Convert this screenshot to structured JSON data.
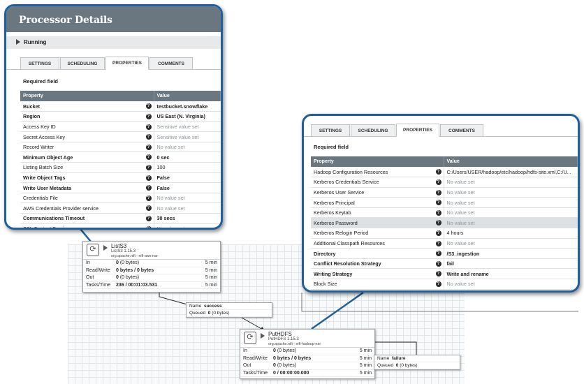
{
  "colors": {
    "callout_border": "#1f5f9c",
    "header_bg": "#6b7780",
    "highlight_row": "#dde1e4"
  },
  "processor_details": {
    "title": "Processor Details",
    "status": "Running",
    "tabs": [
      "SETTINGS",
      "SCHEDULING",
      "PROPERTIES",
      "COMMENTS"
    ],
    "active_tab": "PROPERTIES",
    "required_label": "Required field",
    "columns": [
      "Property",
      "Value"
    ],
    "rows": [
      {
        "name": "Bucket",
        "value": "testbucket.snowflake",
        "required": true,
        "kind": "set"
      },
      {
        "name": "Region",
        "value": "US East (N. Virginia)",
        "required": true,
        "kind": "set"
      },
      {
        "name": "Access Key ID",
        "value": "Sensitive value set",
        "required": false,
        "kind": "none"
      },
      {
        "name": "Secret Access Key",
        "value": "Sensitive value set",
        "required": false,
        "kind": "none"
      },
      {
        "name": "Record Writer",
        "value": "No value set",
        "required": false,
        "kind": "none"
      },
      {
        "name": "Minimum Object Age",
        "value": "0 sec",
        "required": true,
        "kind": "set"
      },
      {
        "name": "Listing Batch Size",
        "value": "100",
        "required": false,
        "kind": "plain"
      },
      {
        "name": "Write Object Tags",
        "value": "False",
        "required": true,
        "kind": "set"
      },
      {
        "name": "Write User Metadata",
        "value": "False",
        "required": true,
        "kind": "set"
      },
      {
        "name": "Credentials File",
        "value": "No value set",
        "required": false,
        "kind": "none"
      },
      {
        "name": "AWS Credentials Provider service",
        "value": "No value set",
        "required": false,
        "kind": "none"
      },
      {
        "name": "Communications Timeout",
        "value": "30 secs",
        "required": true,
        "kind": "set"
      },
      {
        "name": "SSL Context Service",
        "value": "No value set",
        "required": false,
        "kind": "none"
      }
    ]
  },
  "hdfs_properties": {
    "tabs": [
      "SETTINGS",
      "SCHEDULING",
      "PROPERTIES",
      "COMMENTS"
    ],
    "active_tab": "PROPERTIES",
    "required_label": "Required field",
    "columns": [
      "Property",
      "Value"
    ],
    "rows": [
      {
        "name": "Hadoop Configuration Resources",
        "value": "C:/Users/USER/hadoop/etc/hadoop/hdfs-site.xml,C:/U...",
        "required": false,
        "kind": "plain"
      },
      {
        "name": "Kerberos Credentials Service",
        "value": "No value set",
        "required": false,
        "kind": "none"
      },
      {
        "name": "Kerberos User Service",
        "value": "No value set",
        "required": false,
        "kind": "none"
      },
      {
        "name": "Kerberos Principal",
        "value": "No value set",
        "required": false,
        "kind": "none"
      },
      {
        "name": "Kerberos Keytab",
        "value": "No value set",
        "required": false,
        "kind": "none"
      },
      {
        "name": "Kerberos Password",
        "value": "No value set",
        "required": false,
        "kind": "none",
        "highlight": true
      },
      {
        "name": "Kerberos Relogin Period",
        "value": "4 hours",
        "required": false,
        "kind": "plain"
      },
      {
        "name": "Additional Classpath Resources",
        "value": "No value set",
        "required": false,
        "kind": "none"
      },
      {
        "name": "Directory",
        "value": "/S3_ingestion",
        "required": true,
        "kind": "set"
      },
      {
        "name": "Conflict Resolution Strategy",
        "value": "fail",
        "required": true,
        "kind": "set"
      },
      {
        "name": "Writing Strategy",
        "value": "Write and rename",
        "required": true,
        "kind": "set"
      },
      {
        "name": "Block Size",
        "value": "No value set",
        "required": false,
        "kind": "none"
      }
    ]
  },
  "processors": {
    "lists3": {
      "name": "ListS3",
      "version": "ListS3 1.15.3",
      "bundle": "org.apache.nifi - nifi-aws-nar",
      "stats": [
        {
          "label": "In",
          "value_bold": "0",
          "value_rest": " (0 bytes)",
          "time": "5 min"
        },
        {
          "label": "Read/Write",
          "value_bold": "0 bytes / 0 bytes",
          "value_rest": "",
          "time": "5 min"
        },
        {
          "label": "Out",
          "value_bold": "0",
          "value_rest": " (0 bytes)",
          "time": "5 min"
        },
        {
          "label": "Tasks/Time",
          "value_bold": "236 / 00:01:03.531",
          "value_rest": "",
          "time": "5 min"
        }
      ]
    },
    "puthdfs": {
      "name": "PutHDFS",
      "version": "PutHDFS 1.15.3",
      "bundle": "org.apache.nifi - nifi-hadoop-nar",
      "stats": [
        {
          "label": "In",
          "value_bold": "0",
          "value_rest": " (0 bytes)",
          "time": "5 min"
        },
        {
          "label": "Read/Write",
          "value_bold": "0 bytes / 0 bytes",
          "value_rest": "",
          "time": "5 min"
        },
        {
          "label": "Out",
          "value_bold": "0",
          "value_rest": " (0 bytes)",
          "time": "5 min"
        },
        {
          "label": "Tasks/Time",
          "value_bold": "0 / 00:00:00.000",
          "value_rest": "",
          "time": "5 min"
        }
      ]
    }
  },
  "connections": {
    "success": {
      "name_label": "Name",
      "name_value": "success",
      "queued_label": "Queued",
      "queued_bold": "0",
      "queued_rest": " (0 bytes)"
    },
    "failure": {
      "name_label": "Name",
      "name_value": "failure",
      "queued_label": "Queued",
      "queued_bold": "0",
      "queued_rest": " (0 bytes)"
    }
  }
}
